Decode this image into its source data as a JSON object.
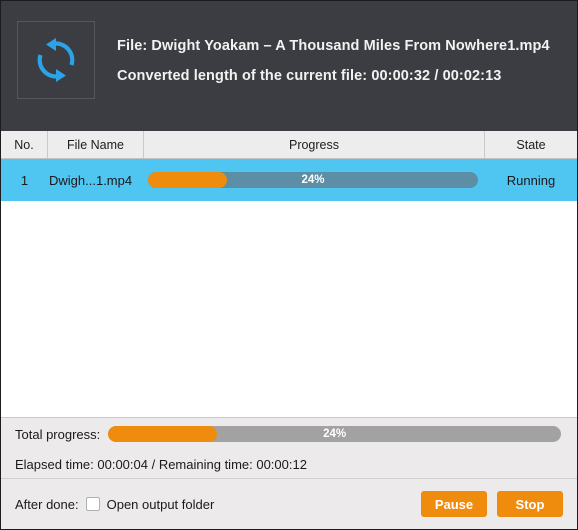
{
  "header": {
    "icon": "refresh-sync-icon",
    "file_line": "File: Dwight Yoakam – A Thousand Miles From Nowhere1.mp4",
    "converted_line": "Converted length of the current file: 00:00:32 / 00:02:13",
    "background_color": "#3b3d42",
    "icon_color": "#2aa3e8"
  },
  "table": {
    "columns": [
      {
        "key": "no",
        "label": "No."
      },
      {
        "key": "name",
        "label": "File Name"
      },
      {
        "key": "prog",
        "label": "Progress"
      },
      {
        "key": "state",
        "label": "State"
      }
    ],
    "rows": [
      {
        "no": "1",
        "name": "Dwigh...1.mp4",
        "progress_percent": 24,
        "progress_label": "24%",
        "state": "Running",
        "selected": true
      }
    ],
    "selection_color": "#4fc5f2",
    "bar_track_color": "#5c8ea6",
    "bar_fill_color": "#ef8c0e"
  },
  "footer": {
    "total_progress_label": "Total progress:",
    "total_progress_percent": 24,
    "total_progress_value": "24%",
    "times_text": "Elapsed time: 00:00:04 / Remaining time: 00:00:12",
    "after_done_label": "After done:",
    "open_output_folder_label": "Open output folder",
    "open_output_folder_checked": false,
    "pause_label": "Pause",
    "stop_label": "Stop",
    "button_color": "#ef8c0e",
    "track_color": "#a2a2a2"
  }
}
